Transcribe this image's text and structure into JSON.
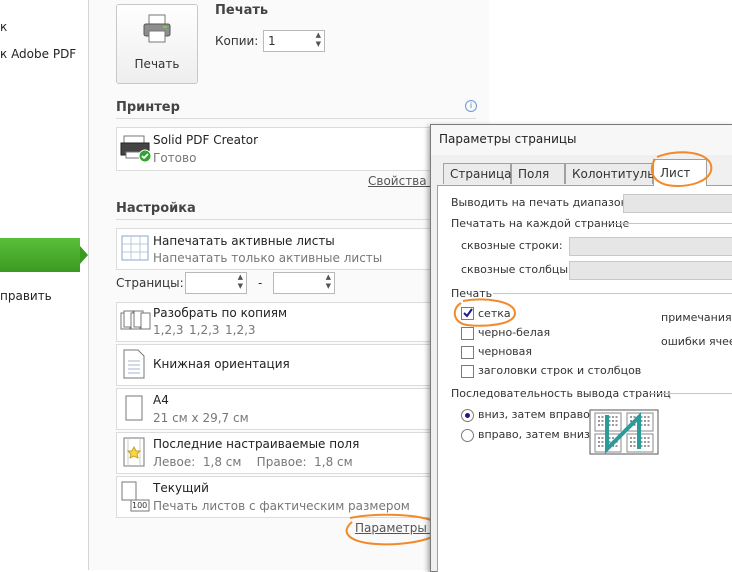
{
  "backstage": {
    "items": [
      {
        "label": "к"
      },
      {
        "label": "к Adobe PDF"
      },
      {
        "label": "править"
      }
    ]
  },
  "print": {
    "button_label": "Печать",
    "section_title": "Печать",
    "copies_label": "Копии:",
    "copies_value": "1"
  },
  "printer": {
    "section_title": "Принтер",
    "name": "Solid PDF Creator",
    "status": "Готово",
    "properties_link": "Свойства п"
  },
  "settings": {
    "section_title": "Настройка",
    "sheets_title": "Напечатать активные листы",
    "sheets_sub": "Напечатать только активные листы",
    "pages_label": "Страницы:",
    "pages_dash": "-",
    "collate_title": "Разобрать по копиям",
    "collate_sub": [
      "1,2,3",
      "1,2,3",
      "1,2,3"
    ],
    "orientation": "Книжная ориентация",
    "paper_title": "A4",
    "paper_sub": "21 см x 29,7 см",
    "margins_title": "Последние настраиваемые поля",
    "margins_sub": "Левое:  1,8 см    Правое:  1,8 см",
    "scaling_title": "Текущий",
    "scaling_sub": "Печать листов с фактическим размером",
    "scaling_icon_text": "100",
    "page_setup_link": "Параметры ст"
  },
  "dialog": {
    "title": "Параметры страницы",
    "tabs": [
      "Страница",
      "Поля",
      "Колонтитулы",
      "Лист"
    ],
    "print_area_label": "Выводить на печать диапазон:",
    "titles_group": "Печатать на каждой странице",
    "rows_label": "сквозные строки:",
    "cols_label": "сквозные столбцы:",
    "print_group": "Печать",
    "gridlines": "сетка",
    "bw": "черно-белая",
    "draft": "черновая",
    "headings": "заголовки строк и столбцов",
    "comments_label": "примечания:",
    "errors_label": "ошибки ячеек",
    "order_group": "Последовательность вывода страниц",
    "order_down": "вниз, затем вправо",
    "order_over": "вправо, затем вниз"
  },
  "colors": {
    "accent_green": "#3a9a22",
    "annotation_orange": "#f08a2a",
    "check_green": "#2fa52f"
  }
}
